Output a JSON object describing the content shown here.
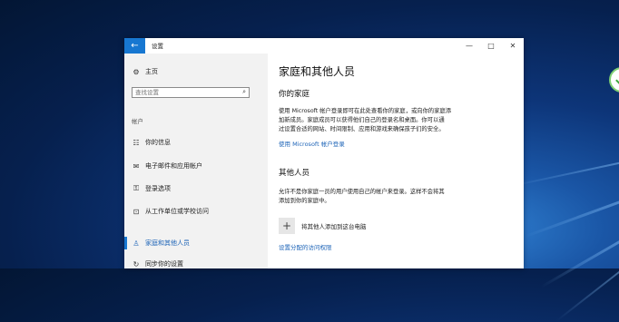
{
  "window": {
    "title": "设置",
    "back_icon": "←",
    "controls": [
      "—",
      "□",
      "✕"
    ]
  },
  "sidebar": {
    "home_label": "主页",
    "search_placeholder": "查找设置",
    "section_label": "帐户",
    "items": [
      {
        "label": "你的信息",
        "icon": "person-card-icon"
      },
      {
        "label": "电子邮件和应用帐户",
        "icon": "mail-icon"
      },
      {
        "label": "登录选项",
        "icon": "key-icon"
      },
      {
        "label": "从工作单位或学校访问",
        "icon": "briefcase-icon"
      },
      {
        "label": "家庭和其他人员",
        "icon": "person-icon",
        "active": true
      },
      {
        "label": "同步你的设置",
        "icon": "sync-icon"
      }
    ]
  },
  "main": {
    "page_title": "家庭和其他人员",
    "family_heading": "你的家庭",
    "family_text_lines": [
      "使用 Microsoft 帐户登录即可在此处查看你的家庭，或向你的家庭添",
      "加新成员。家庭成员可以获得他们自己的登录名和桌面。你可以通",
      "过设置合适的网站、时间限制、应用和游戏来确保孩子们的安全。"
    ],
    "family_link": "使用 Microsoft 帐户登录",
    "others_heading": "其他人员",
    "others_text_lines": [
      "允许不是你家庭一员的用户使用自己的帐户来登录。这样不会将其",
      "添加到你的家庭中。"
    ],
    "add_icon": "+",
    "add_label": "将其他人添加到这台电脑",
    "access_link": "设置分配的访问权限"
  },
  "colors": {
    "accent": "#1777d1",
    "link": "#1c63b7",
    "sidebar_bg": "#f2f2f2"
  }
}
